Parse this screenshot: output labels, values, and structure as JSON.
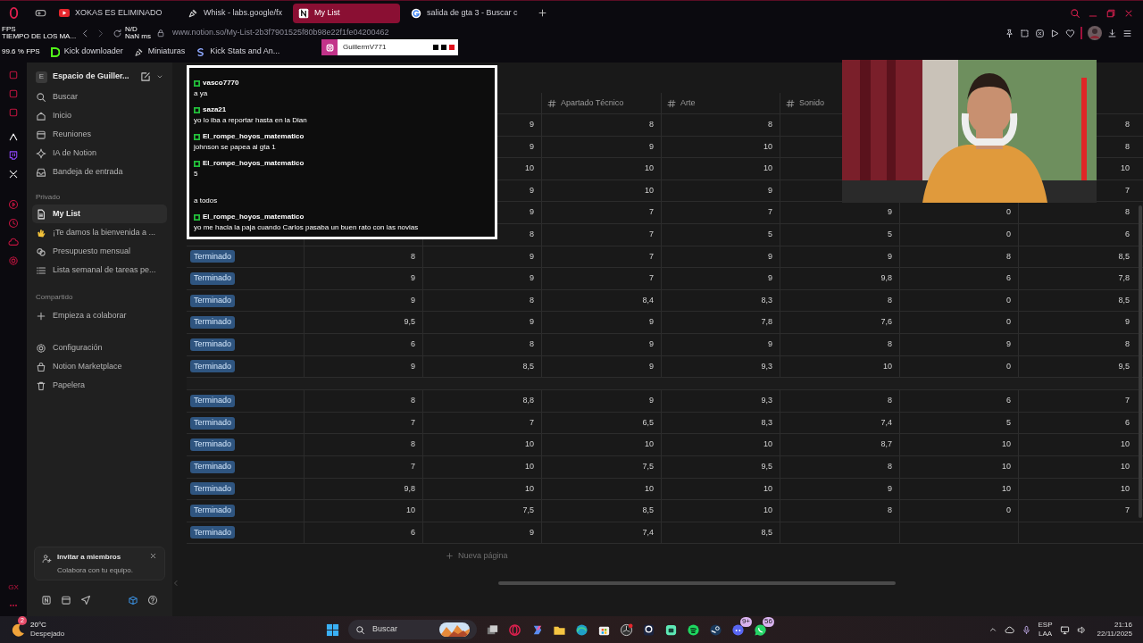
{
  "browser": {
    "tabs": [
      {
        "label": "XOKAS ES ELIMINADO",
        "selected": false
      },
      {
        "label": "Whisk - labs.google/fx",
        "selected": false
      },
      {
        "label": "My List",
        "selected": true
      },
      {
        "label": "salida de gta 3 - Buscar c",
        "selected": false
      }
    ],
    "address": "www.notion.so/My-List-2b3f7901525f80b98e22f1fe04200462",
    "bookmarks": [
      "Kick downloader",
      "Miniaturas",
      "Kick Stats and An..."
    ]
  },
  "stats_overlay": {
    "fps_label": "FPS",
    "frame_time_label": "TIEMPO DE LOS MA...",
    "frame_time": "N/D",
    "latency": "NaN ms",
    "fps": "99.6 % FPS"
  },
  "instagram_overlay": {
    "handle": "GuillermV771"
  },
  "opera_sidebar": {
    "label": "GX"
  },
  "notion_sidebar": {
    "workspace_initial": "E",
    "workspace": "Espacio de Guiller...",
    "nav": [
      "Buscar",
      "Inicio",
      "Reuniones",
      "IA de Notion",
      "Bandeja de entrada"
    ],
    "sections": [
      {
        "title": "Privado",
        "items": [
          {
            "label": "My List",
            "selected": true
          },
          {
            "label": "¡Te damos la bienvenida a ...",
            "selected": false
          },
          {
            "label": "Presupuesto mensual",
            "selected": false
          },
          {
            "label": "Lista semanal de tareas pe...",
            "selected": false
          }
        ]
      },
      {
        "title": "Compartido",
        "items": [
          {
            "label": "Empieza a colaborar",
            "selected": false
          }
        ]
      }
    ],
    "footer": [
      "Configuración",
      "Notion Marketplace",
      "Papelera"
    ],
    "invite": {
      "title": "Invitar a miembros",
      "subtitle": "Colabora con tu equipo."
    }
  },
  "table": {
    "columns": [
      null,
      null,
      null,
      {
        "label": "Apartado Técnico"
      },
      {
        "label": "Arte"
      },
      {
        "label": "Sonido"
      },
      null,
      null
    ],
    "rows": [
      {
        "status": null,
        "cells": [
          null,
          "9",
          "8",
          "8",
          null,
          null,
          "8"
        ]
      },
      {
        "status": null,
        "cells": [
          null,
          "9",
          "9",
          "10",
          null,
          null,
          "8"
        ]
      },
      {
        "status": null,
        "cells": [
          null,
          "10",
          "10",
          "10",
          null,
          null,
          "10"
        ]
      },
      {
        "status": null,
        "cells": [
          null,
          "9",
          "10",
          "9",
          null,
          null,
          "7"
        ]
      },
      {
        "status": null,
        "cells": [
          null,
          "9",
          "7",
          "7",
          "9",
          "0",
          "8"
        ]
      },
      {
        "status": null,
        "cells": [
          null,
          "8",
          "7",
          "5",
          "5",
          "0",
          "6"
        ]
      },
      {
        "status": "Terminado",
        "cells": [
          "8",
          "9",
          "7",
          "9",
          "9",
          "8",
          "8,5"
        ]
      },
      {
        "status": "Terminado",
        "cells": [
          "9",
          "9",
          "7",
          "9",
          "9,8",
          "6",
          "7,8"
        ]
      },
      {
        "status": "Terminado",
        "cells": [
          "9",
          "8",
          "8,4",
          "8,3",
          "8",
          "0",
          "8,5"
        ]
      },
      {
        "status": "Terminado",
        "cells": [
          "9,5",
          "9",
          "9",
          "7,8",
          "7,6",
          "0",
          "9"
        ]
      },
      {
        "status": "Terminado",
        "cells": [
          "6",
          "8",
          "9",
          "9",
          "8",
          "9",
          "8"
        ]
      },
      {
        "status": "Terminado",
        "cells": [
          "9",
          "8,5",
          "9",
          "9,3",
          "10",
          "0",
          "9,5"
        ]
      },
      {
        "status": "Terminado",
        "break_before": true,
        "cells": [
          "8",
          "8,8",
          "9",
          "9,3",
          "8",
          "6",
          "7"
        ]
      },
      {
        "status": "Terminado",
        "cells": [
          "7",
          "7",
          "6,5",
          "8,3",
          "7,4",
          "5",
          "6"
        ]
      },
      {
        "status": "Terminado",
        "cells": [
          "8",
          "10",
          "10",
          "10",
          "8,7",
          "10",
          "10"
        ]
      },
      {
        "status": "Terminado",
        "cells": [
          "7",
          "10",
          "7,5",
          "9,5",
          "8",
          "10",
          "10"
        ]
      },
      {
        "status": "Terminado",
        "cells": [
          "9,8",
          "10",
          "10",
          "10",
          "9",
          "10",
          "10"
        ]
      },
      {
        "status": "Terminado",
        "cells": [
          "10",
          "7,5",
          "8,5",
          "10",
          "8",
          "0",
          "7"
        ]
      },
      {
        "status": "Terminado",
        "cells": [
          "6",
          "9",
          "7,4",
          "8,5",
          null,
          null,
          null
        ]
      }
    ],
    "new_page": "Nueva página"
  },
  "chat": [
    {
      "user": "vasco7770",
      "message": "a ya"
    },
    {
      "user": "saza21",
      "message": "yo lo iba a reportar hasta en la Dian"
    },
    {
      "user": "El_rompe_hoyos_matematico",
      "message": "johnson se papea al gta 1"
    },
    {
      "user": "El_rompe_hoyos_matematico",
      "message": "5"
    },
    {
      "message": "a todos"
    },
    {
      "user": "El_rompe_hoyos_matematico",
      "message": "yo me hacia la paja cuando Carlos pasaba un buen rato con las novias"
    }
  ],
  "taskbar": {
    "weather": {
      "badge": "2",
      "temp": "20°C",
      "condition": "Despejado"
    },
    "search": "Buscar",
    "discord_badge": "9+",
    "whatsapp_badge": "56",
    "language": "ESP",
    "layout": "LAA",
    "time": "21:16",
    "date": "22/11/2025"
  }
}
